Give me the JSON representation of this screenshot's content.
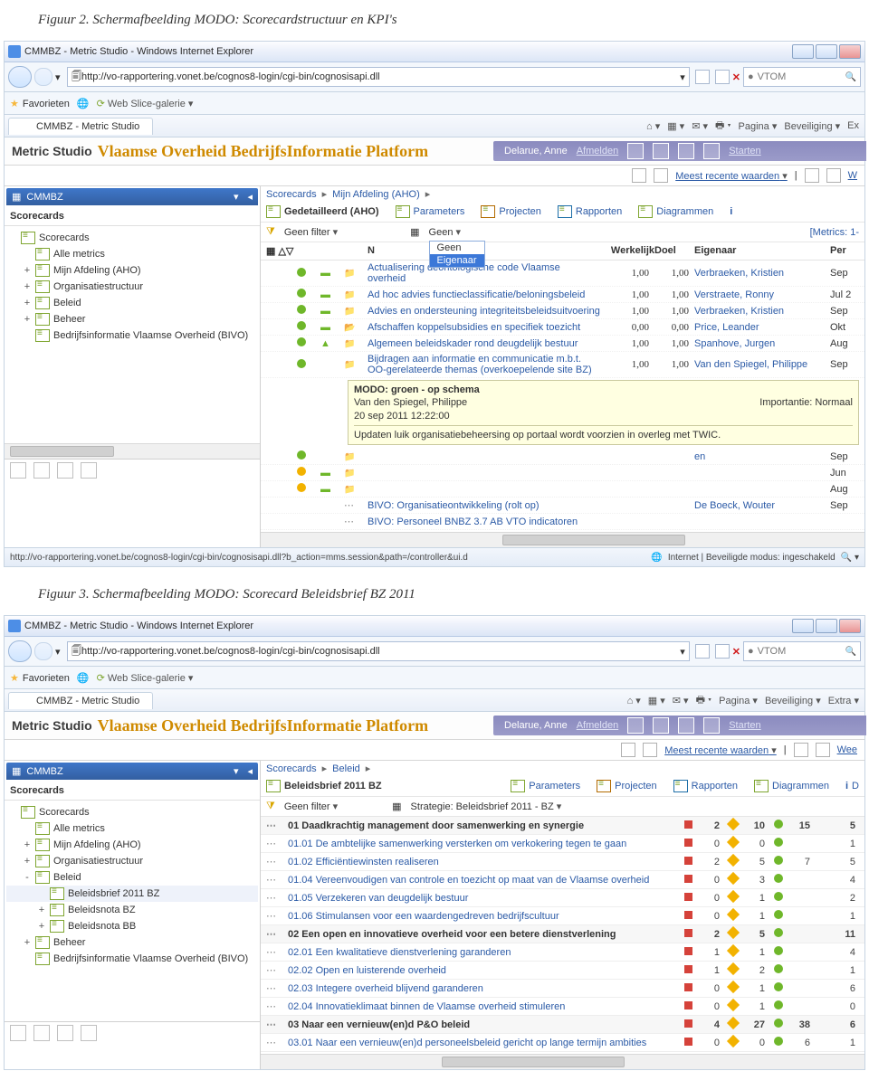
{
  "figures": {
    "fig2": "Figuur 2. Schermafbeelding MODO: Scorecardstructuur en KPI's",
    "fig3": "Figuur 3. Schermafbeelding MODO: Scorecard Beleidsbrief BZ 2011"
  },
  "ie": {
    "title": "CMMBZ - Metric Studio - Windows Internet Explorer",
    "url": "http://vo-rapportering.vonet.be/cognos8-login/cgi-bin/cognosisapi.dll",
    "search": "VTOM",
    "fav": "Favorieten",
    "gallery": "Web Slice-galerie ▾",
    "tab": "CMMBZ - Metric Studio",
    "tools": {
      "pagina": "Pagina",
      "beveiliging": "Beveiliging",
      "extra": "Extra",
      "ex_short": "Ex"
    },
    "status_url": "http://vo-rapportering.vonet.be/cognos8-login/cgi-bin/cognosisapi.dll?b_action=mms.session&path=/controller&ui.d",
    "status_zone": "Internet | Beveiligde modus: ingeschakeld"
  },
  "app": {
    "name": "Metric Studio",
    "brand": "Vlaamse Overheid BedrijfsInformatie Platform",
    "user": "Delarue, Anne",
    "logoff": "Afmelden",
    "start": "Starten",
    "recent": "Meest recente waarden",
    "weerg": "W",
    "weerg2": "Wee"
  },
  "left": {
    "cmmbz": "CMMBZ",
    "scorecards_hdr": "Scorecards",
    "tree1": [
      {
        "exp": "",
        "label": "Scorecards"
      },
      {
        "exp": "",
        "label": "Alle metrics",
        "indent": 1
      },
      {
        "exp": "+",
        "label": "Mijn Afdeling (AHO)",
        "indent": 1
      },
      {
        "exp": "+",
        "label": "Organisatiestructuur",
        "indent": 1
      },
      {
        "exp": "+",
        "label": "Beleid",
        "indent": 1
      },
      {
        "exp": "+",
        "label": "Beheer",
        "indent": 1
      },
      {
        "exp": "",
        "label": "Bedrijfsinformatie Vlaamse Overheid (BIVO)",
        "indent": 1
      }
    ],
    "tree2": [
      {
        "exp": "",
        "label": "Scorecards"
      },
      {
        "exp": "",
        "label": "Alle metrics",
        "indent": 1
      },
      {
        "exp": "+",
        "label": "Mijn Afdeling (AHO)",
        "indent": 1
      },
      {
        "exp": "+",
        "label": "Organisatiestructuur",
        "indent": 1
      },
      {
        "exp": "-",
        "label": "Beleid",
        "indent": 1
      },
      {
        "exp": "",
        "label": "Beleidsbrief 2011 BZ",
        "indent": 2,
        "sel": true
      },
      {
        "exp": "+",
        "label": "Beleidsnota BZ",
        "indent": 2
      },
      {
        "exp": "+",
        "label": "Beleidsnota BB",
        "indent": 2
      },
      {
        "exp": "+",
        "label": "Beheer",
        "indent": 1
      },
      {
        "exp": "",
        "label": "Bedrijfsinformatie Vlaamse Overheid (BIVO)",
        "indent": 1
      }
    ]
  },
  "top1": {
    "crumbs": [
      "Scorecards",
      "Mijn Afdeling (AHO)"
    ],
    "tabs": [
      "Gedetailleerd (AHO)",
      "Parameters",
      "Projecten",
      "Rapporten",
      "Diagrammen"
    ],
    "active_tab": 0,
    "filter_label": "Geen filter",
    "dd2_placeholder": "Geen",
    "dd2_options": [
      "Geen",
      "Eigenaar"
    ],
    "metrics_count": "[Metrics: 1-",
    "cols": {
      "n": "N",
      "werkelijk": "Werkelijk",
      "doel": "Doel",
      "eigenaar": "Eigenaar",
      "per": "Per"
    },
    "rows": [
      {
        "status": "green",
        "trend": "flat",
        "folder": "closed",
        "name": "Actualisering deontologische code Vlaamse overheid",
        "w": "1,00",
        "d": "1,00",
        "own": "Verbraeken, Kristien",
        "per": "Sep"
      },
      {
        "status": "green",
        "trend": "flat",
        "folder": "closed",
        "name": "Ad hoc advies functieclassificatie/beloningsbeleid",
        "w": "1,00",
        "d": "1,00",
        "own": "Verstraete, Ronny",
        "per": "Jul 2"
      },
      {
        "status": "green",
        "trend": "flat",
        "folder": "closed",
        "name": "Advies en ondersteuning integriteitsbeleidsuitvoering",
        "w": "1,00",
        "d": "1,00",
        "own": "Verbraeken, Kristien",
        "per": "Sep"
      },
      {
        "status": "green",
        "trend": "flat",
        "folder": "open",
        "name": "Afschaffen koppelsubsidies en specifiek toezicht",
        "w": "0,00",
        "d": "0,00",
        "own": "Price, Leander",
        "per": "Okt"
      },
      {
        "status": "green",
        "trend": "up",
        "folder": "closed",
        "name": "Algemeen beleidskader rond deugdelijk bestuur",
        "w": "1,00",
        "d": "1,00",
        "own": "Spanhove, Jurgen",
        "per": "Aug"
      },
      {
        "status": "green",
        "trend": "",
        "folder": "closed",
        "name": "Bijdragen aan informatie en communicatie m.b.t. OO-gerelateerde themas (overkoepelende site BZ)",
        "w": "1,00",
        "d": "1,00",
        "own": "Van den Spiegel, Philippe",
        "per": "Sep"
      }
    ],
    "tooltip": {
      "title": "MODO: groen - op schema",
      "author": "Van den Spiegel, Philippe",
      "time": "20 sep 2011 12:22:00",
      "imp": "Importantie: Normaal",
      "body": "Updaten luik organisatiebeheersing op portaal wordt voorzien in overleg met TWIC."
    },
    "tail": [
      {
        "status": "green",
        "name": "",
        "own": "en",
        "per": "Sep"
      },
      {
        "status": "orange",
        "trend": "flat",
        "per": "Jun"
      },
      {
        "status": "orange",
        "trend": "flat",
        "per": "Aug"
      },
      {
        "folder": "dots",
        "name": "BIVO: Organisatieontwikkeling (rolt op)",
        "own": "De Boeck, Wouter",
        "per": "Sep"
      },
      {
        "folder": "dots",
        "name": "BIVO: Personeel BNBZ 3.7 AB VTO indicatoren",
        "own": "",
        "per": ""
      }
    ]
  },
  "top2": {
    "crumbs": [
      "Scorecards",
      "Beleid"
    ],
    "sc_name": "Beleidsbrief 2011 BZ",
    "tabs": [
      "Parameters",
      "Projecten",
      "Rapporten",
      "Diagrammen",
      "D"
    ],
    "filter_label": "Geen filter",
    "strategie": "Strategie: Beleidsbrief 2011 - BZ",
    "rows": [
      {
        "section": true,
        "name": "01 Daadkrachtig management door samenwerking en synergie",
        "r": 2,
        "o": 10,
        "g": 15,
        "x": 5
      },
      {
        "name": "01.01 De ambtelijke samenwerking versterken om verkokering tegen te gaan",
        "r": 0,
        "o": 0,
        "g": "",
        "x": 1
      },
      {
        "name": "01.02 Efficiëntiewinsten realiseren",
        "r": 2,
        "o": 5,
        "g": 7,
        "x": 5
      },
      {
        "name": "01.04 Vereenvoudigen van controle en toezicht op maat van de Vlaamse overheid",
        "r": 0,
        "o": 3,
        "g": "",
        "x": 4
      },
      {
        "name": "01.05 Verzekeren van deugdelijk bestuur",
        "r": 0,
        "o": 1,
        "g": "",
        "x": 2
      },
      {
        "name": "01.06 Stimulansen voor een waardengedreven bedrijfscultuur",
        "r": 0,
        "o": 1,
        "g": "",
        "x": 1
      },
      {
        "section": true,
        "name": "02 Een open en innovatieve overheid voor een betere dienstverlening",
        "r": 2,
        "o": 5,
        "g": "",
        "x": 11
      },
      {
        "name": "02.01 Een kwalitatieve dienstverlening garanderen",
        "r": 1,
        "o": 1,
        "g": "",
        "x": 4
      },
      {
        "name": "02.02 Open en luisterende overheid",
        "r": 1,
        "o": 2,
        "g": "",
        "x": 1
      },
      {
        "name": "02.03 Integere overheid blijvend garanderen",
        "r": 0,
        "o": 1,
        "g": "",
        "x": 6
      },
      {
        "name": "02.04 Innovatieklimaat binnen de Vlaamse overheid stimuleren",
        "r": 0,
        "o": 1,
        "g": "",
        "x": 0
      },
      {
        "section": true,
        "name": "03 Naar een vernieuw(en)d P&O beleid",
        "r": 4,
        "o": 27,
        "g": 38,
        "x": 6
      },
      {
        "name": "03.01 Naar een vernieuw(en)d personeelsbeleid gericht op lange termijn ambities",
        "r": 0,
        "o": 0,
        "g": 6,
        "x": 1
      }
    ]
  }
}
